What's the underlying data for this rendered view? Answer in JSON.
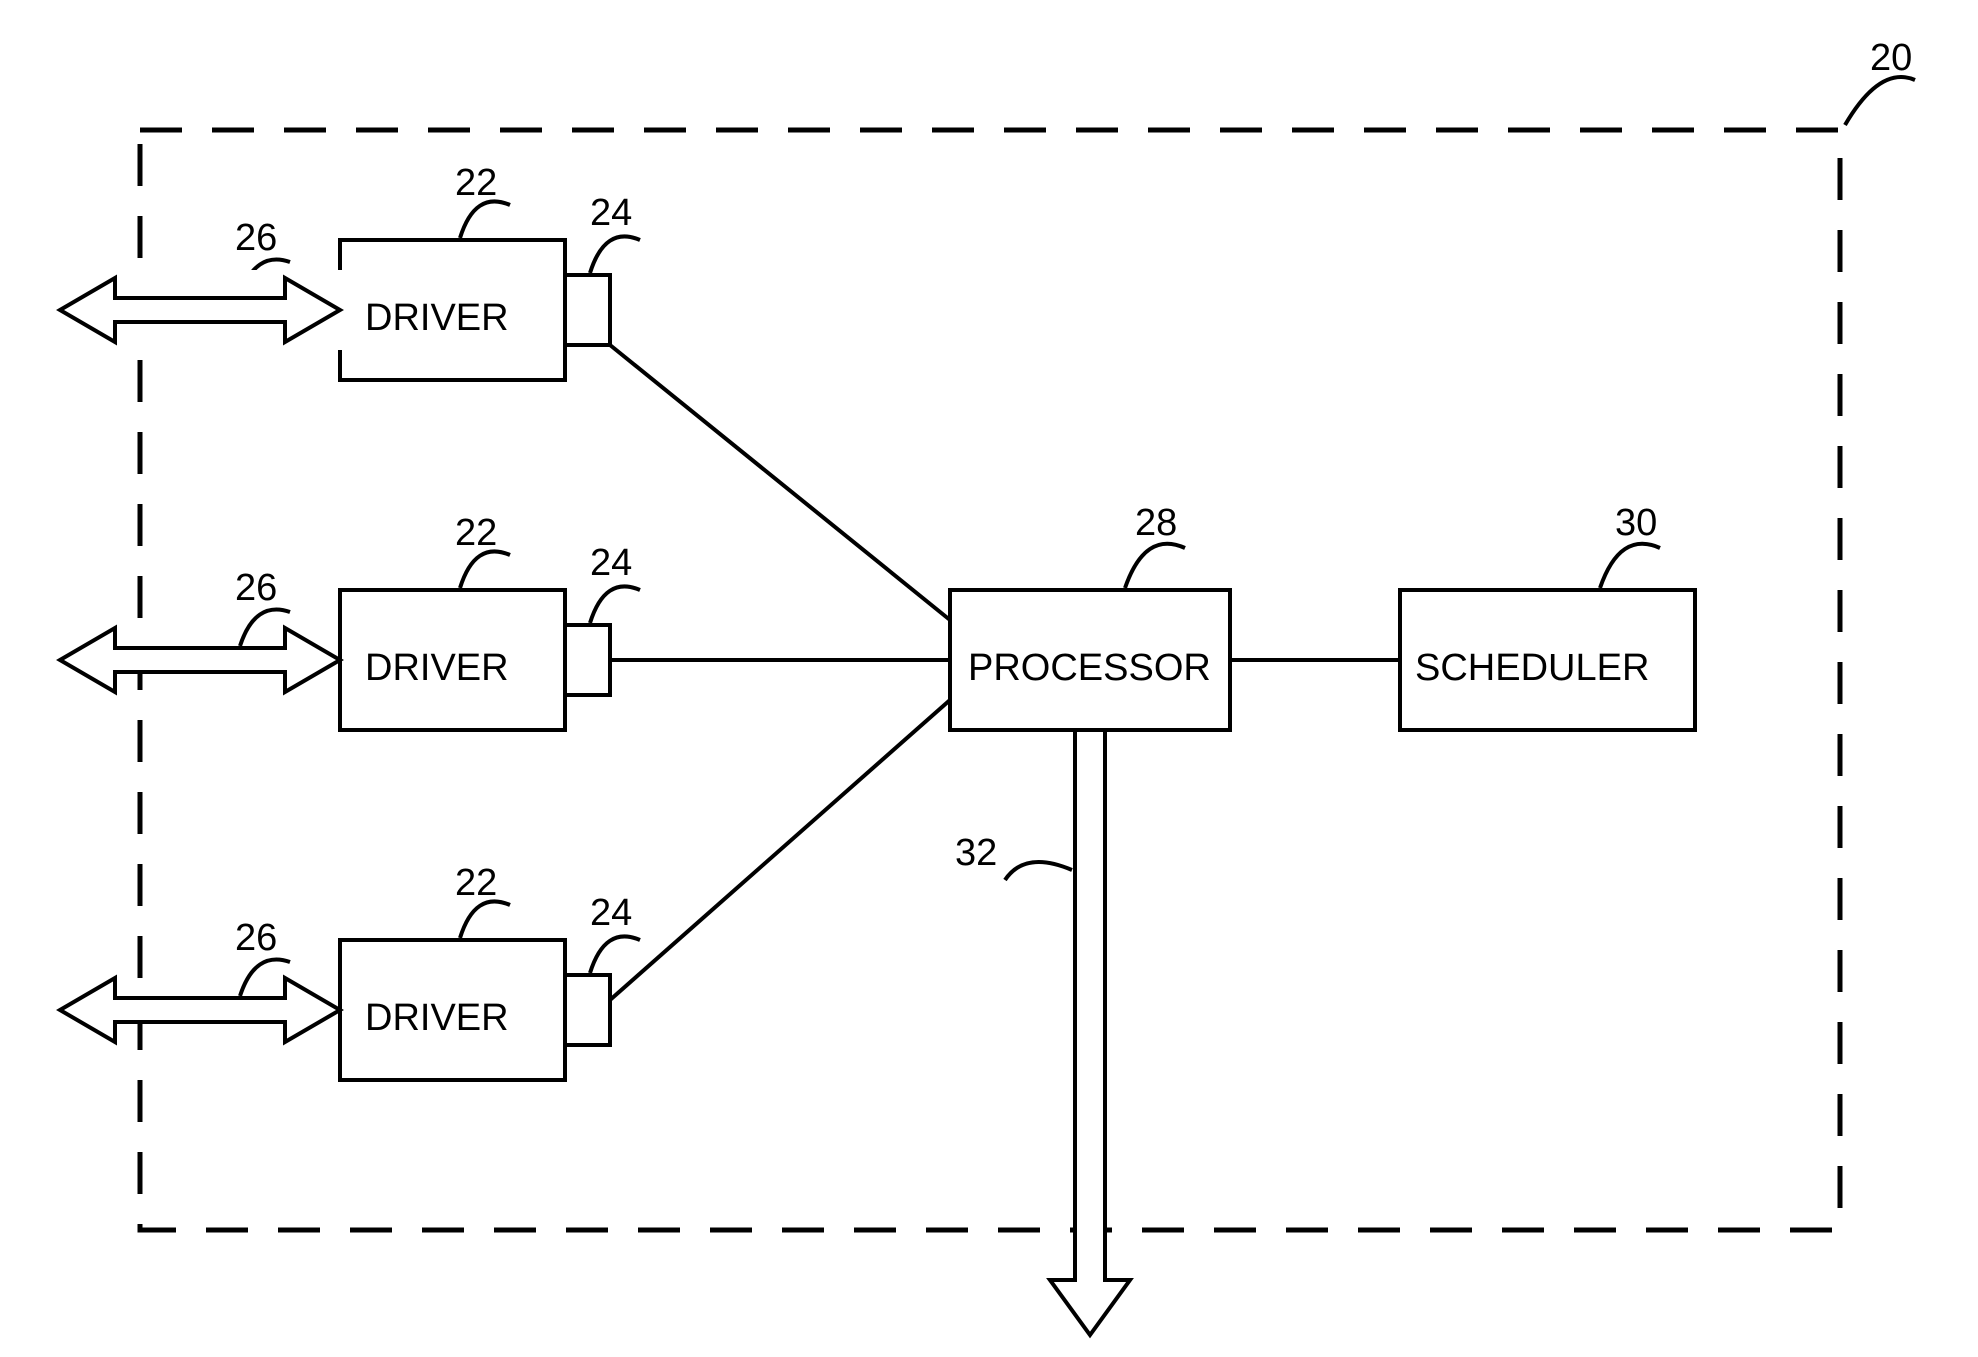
{
  "container_ref": "20",
  "drivers": [
    {
      "block_ref": "22",
      "small_ref": "24",
      "arrow_ref": "26",
      "label": "DRIVER"
    },
    {
      "block_ref": "22",
      "small_ref": "24",
      "arrow_ref": "26",
      "label": "DRIVER"
    },
    {
      "block_ref": "22",
      "small_ref": "24",
      "arrow_ref": "26",
      "label": "DRIVER"
    }
  ],
  "processor": {
    "ref": "28",
    "label": "PROCESSOR"
  },
  "scheduler": {
    "ref": "30",
    "label": "SCHEDULER"
  },
  "out_arrow_ref": "32"
}
